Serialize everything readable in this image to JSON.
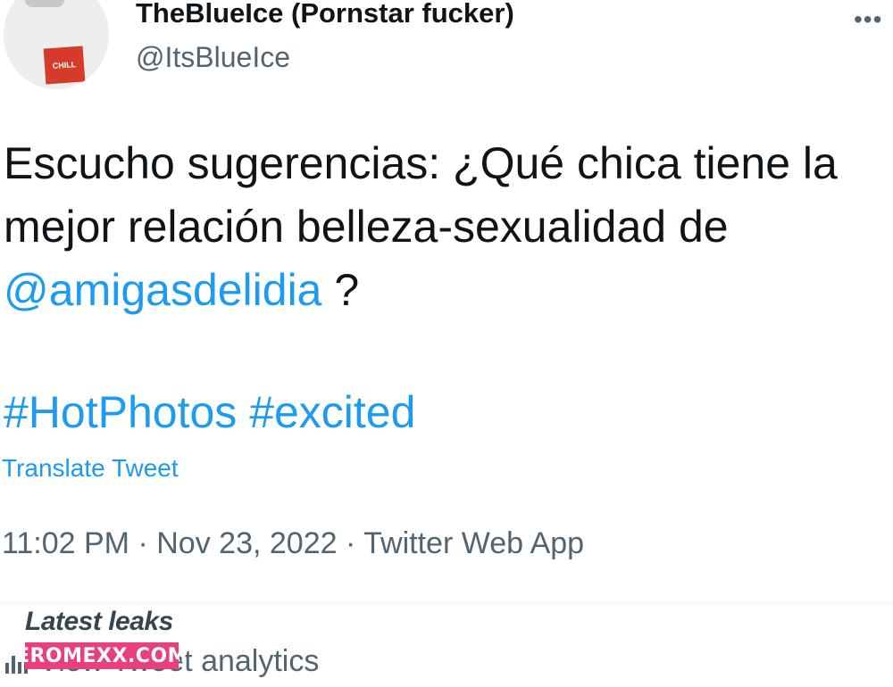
{
  "author": {
    "display_name": "TheBlueIce (Pornstar fucker)",
    "handle": "@ItsBlueIce",
    "avatar_pack_label": "CHILL"
  },
  "menu_icon": "more-horizontal-icon",
  "tweet": {
    "text_before": "Escucho sugerencias: ¿Qué chica tiene la mejor relación belleza-sexualidad de ",
    "mention": "@amigasdelidia",
    "text_after": " ?",
    "hashtags": [
      "#HotPhotos",
      "#excited"
    ],
    "translate_label": "Translate Tweet"
  },
  "meta": {
    "time": "11:02 PM",
    "separator": "·",
    "date": "Nov 23, 2022",
    "source": "Twitter Web App"
  },
  "analytics": {
    "label": "View Tweet analytics",
    "icon": "analytics-icon"
  },
  "watermark": {
    "title": "Latest leaks",
    "site": "EROMEXX.COM"
  },
  "colors": {
    "link": "#1d9bf0",
    "secondary_text": "#536471",
    "primary_text": "#0f1419",
    "watermark_pink": "#e7407a"
  }
}
